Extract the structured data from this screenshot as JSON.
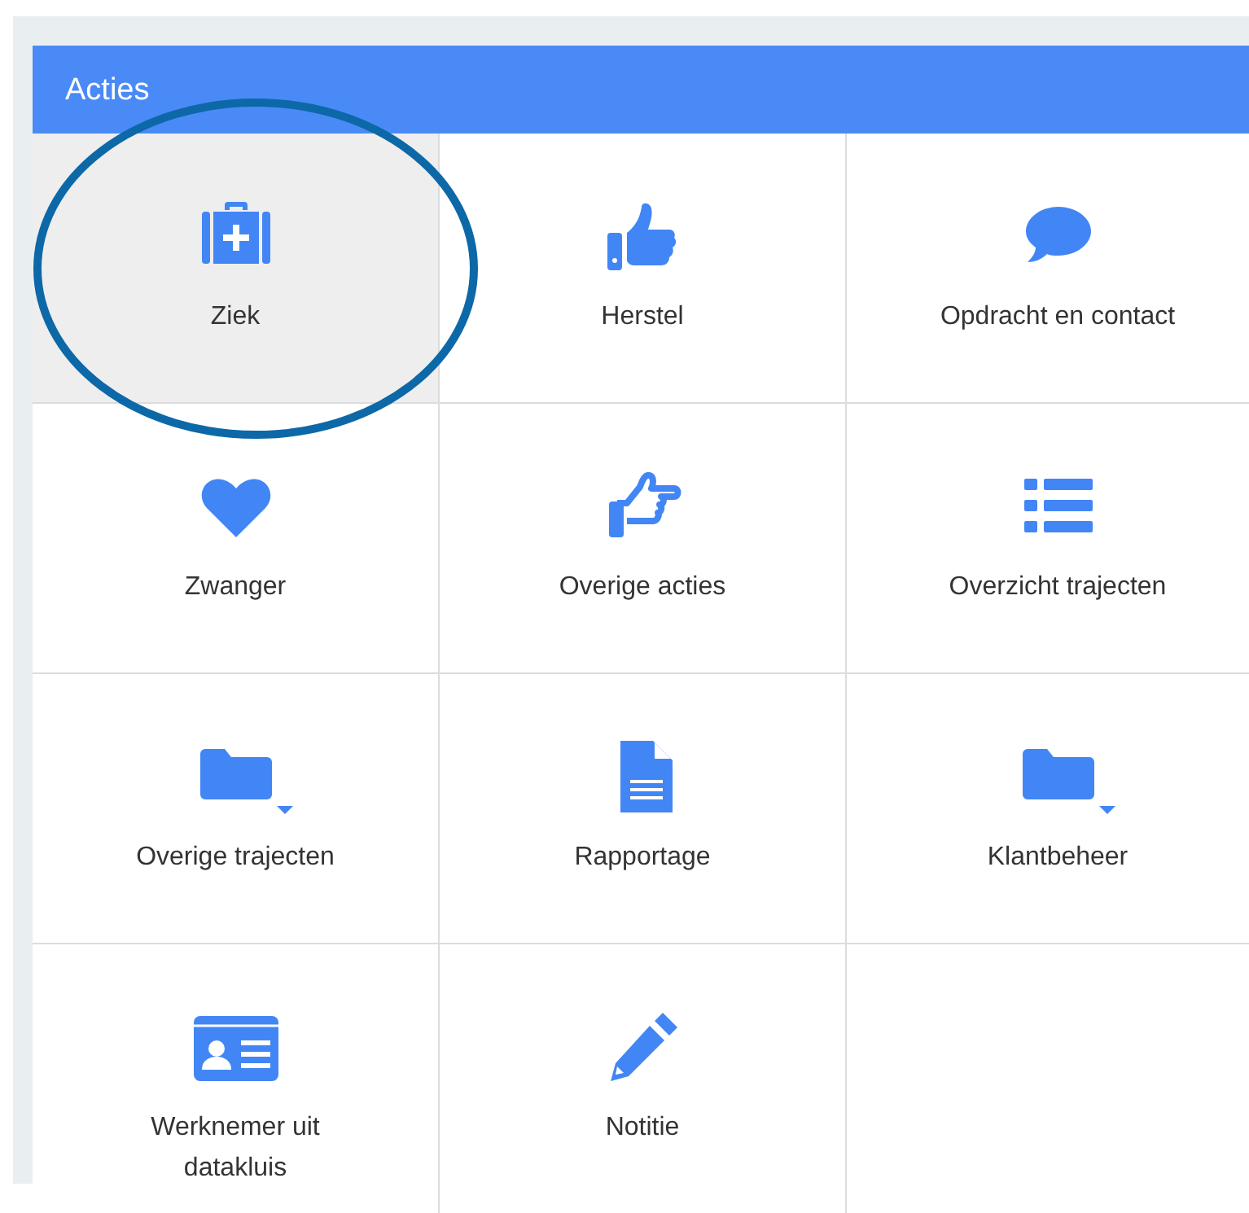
{
  "panel": {
    "title": "Acties"
  },
  "actions": [
    {
      "label": "Ziek",
      "selected": true
    },
    {
      "label": "Herstel",
      "selected": false
    },
    {
      "label": "Opdracht en contact",
      "selected": false
    },
    {
      "label": "Zwanger",
      "selected": false
    },
    {
      "label": "Overige acties",
      "selected": false
    },
    {
      "label": "Overzicht trajecten",
      "selected": false
    },
    {
      "label": "Overige trajecten",
      "selected": false
    },
    {
      "label": "Rapportage",
      "selected": false
    },
    {
      "label": "Klantbeheer",
      "selected": false
    },
    {
      "label": "Werknemer uit datakluis",
      "selected": false
    },
    {
      "label": "Notitie",
      "selected": false
    }
  ],
  "annotation": {
    "kind": "ellipse"
  }
}
